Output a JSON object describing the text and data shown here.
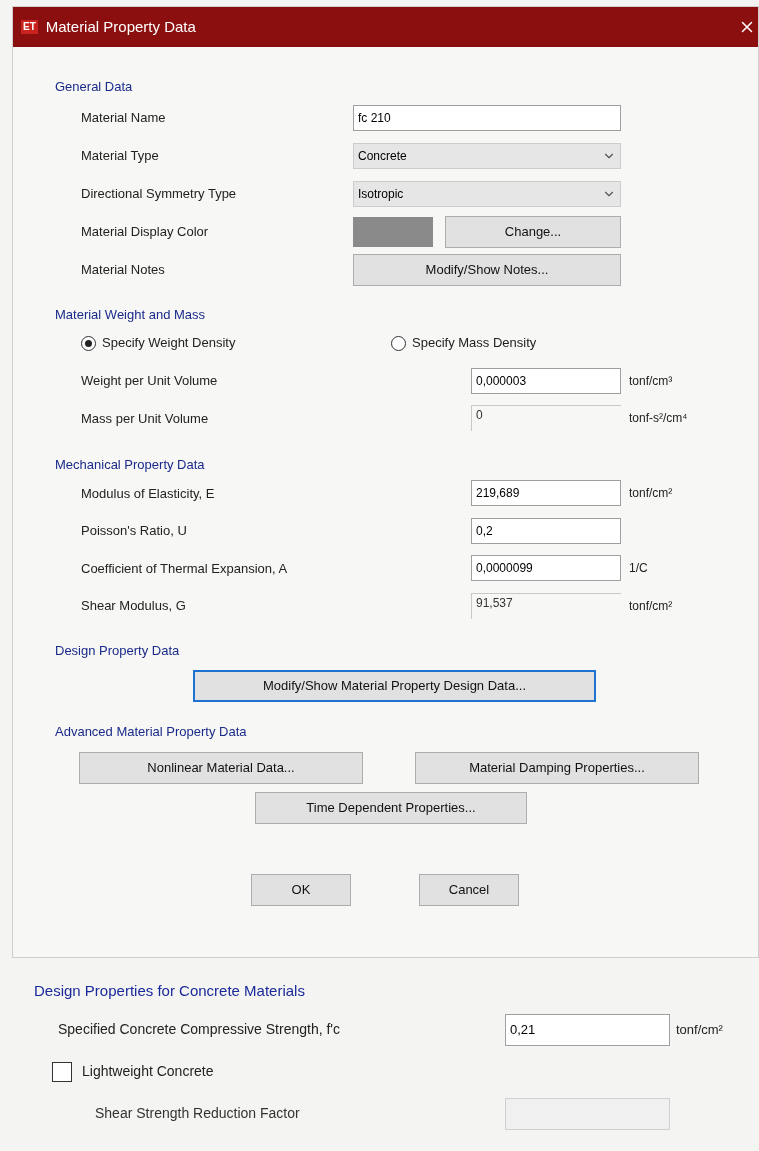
{
  "window": {
    "app_badge": "ET",
    "title": "Material Property Data"
  },
  "general": {
    "heading": "General Data",
    "rows": [
      {
        "kind": "text",
        "label": "Material Name",
        "value": "fc 210"
      },
      {
        "kind": "dropdown",
        "label": "Material Type",
        "value": "Concrete"
      },
      {
        "kind": "dropdown",
        "label": "Directional Symmetry Type",
        "value": "Isotropic"
      },
      {
        "kind": "color",
        "label": "Material Display Color",
        "color": "#8a8a8a",
        "button": "Change..."
      },
      {
        "kind": "button",
        "label": "Material Notes",
        "button": "Modify/Show Notes..."
      }
    ]
  },
  "weight": {
    "heading": "Material Weight and Mass",
    "options": [
      {
        "label": "Specify Weight Density",
        "selected": true
      },
      {
        "label": "Specify Mass Density",
        "selected": false
      }
    ],
    "rows": [
      {
        "kind": "text",
        "label": "Weight per Unit Volume",
        "value": "0,000003",
        "unit": "tonf/cm³"
      },
      {
        "kind": "readonly",
        "label": "Mass per Unit Volume",
        "value": "0",
        "unit": "tonf-s²/cm⁴"
      }
    ]
  },
  "mechanical": {
    "heading": "Mechanical Property Data",
    "rows": [
      {
        "kind": "text",
        "label": "Modulus of Elasticity,  E",
        "value": "219,689",
        "unit": "tonf/cm²"
      },
      {
        "kind": "text",
        "label": "Poisson's Ratio,  U",
        "value": "0,2"
      },
      {
        "kind": "text",
        "label": "Coefficient of Thermal Expansion,  A",
        "value": "0,0000099",
        "unit": "1/C"
      },
      {
        "kind": "readonly",
        "label": "Shear Modulus,  G",
        "value": "91,537",
        "unit": "tonf/cm²"
      }
    ]
  },
  "design": {
    "heading": "Design Property Data",
    "button": {
      "label": "Modify/Show Material Property Design Data...",
      "focused": true
    }
  },
  "advanced": {
    "heading": "Advanced Material Property Data",
    "buttons": [
      {
        "label": "Nonlinear Material Data...",
        "focused": false
      },
      {
        "label": "Material Damping Properties...",
        "focused": false
      },
      {
        "label": "Time Dependent Properties...",
        "focused": false
      }
    ]
  },
  "footer": {
    "buttons": [
      {
        "label": "OK",
        "focused": false
      },
      {
        "label": "Cancel",
        "focused": false
      }
    ]
  },
  "concrete_panel": {
    "heading": "Design Properties for Concrete Materials",
    "strength": {
      "label": "Specified Concrete Compressive Strength, f'c",
      "value": "0,21",
      "unit": "tonf/cm²"
    },
    "lightweight": {
      "label": "Lightweight Concrete",
      "checked": false
    },
    "shear_factor": {
      "label": "Shear Strength Reduction Factor",
      "disabled": true
    }
  }
}
